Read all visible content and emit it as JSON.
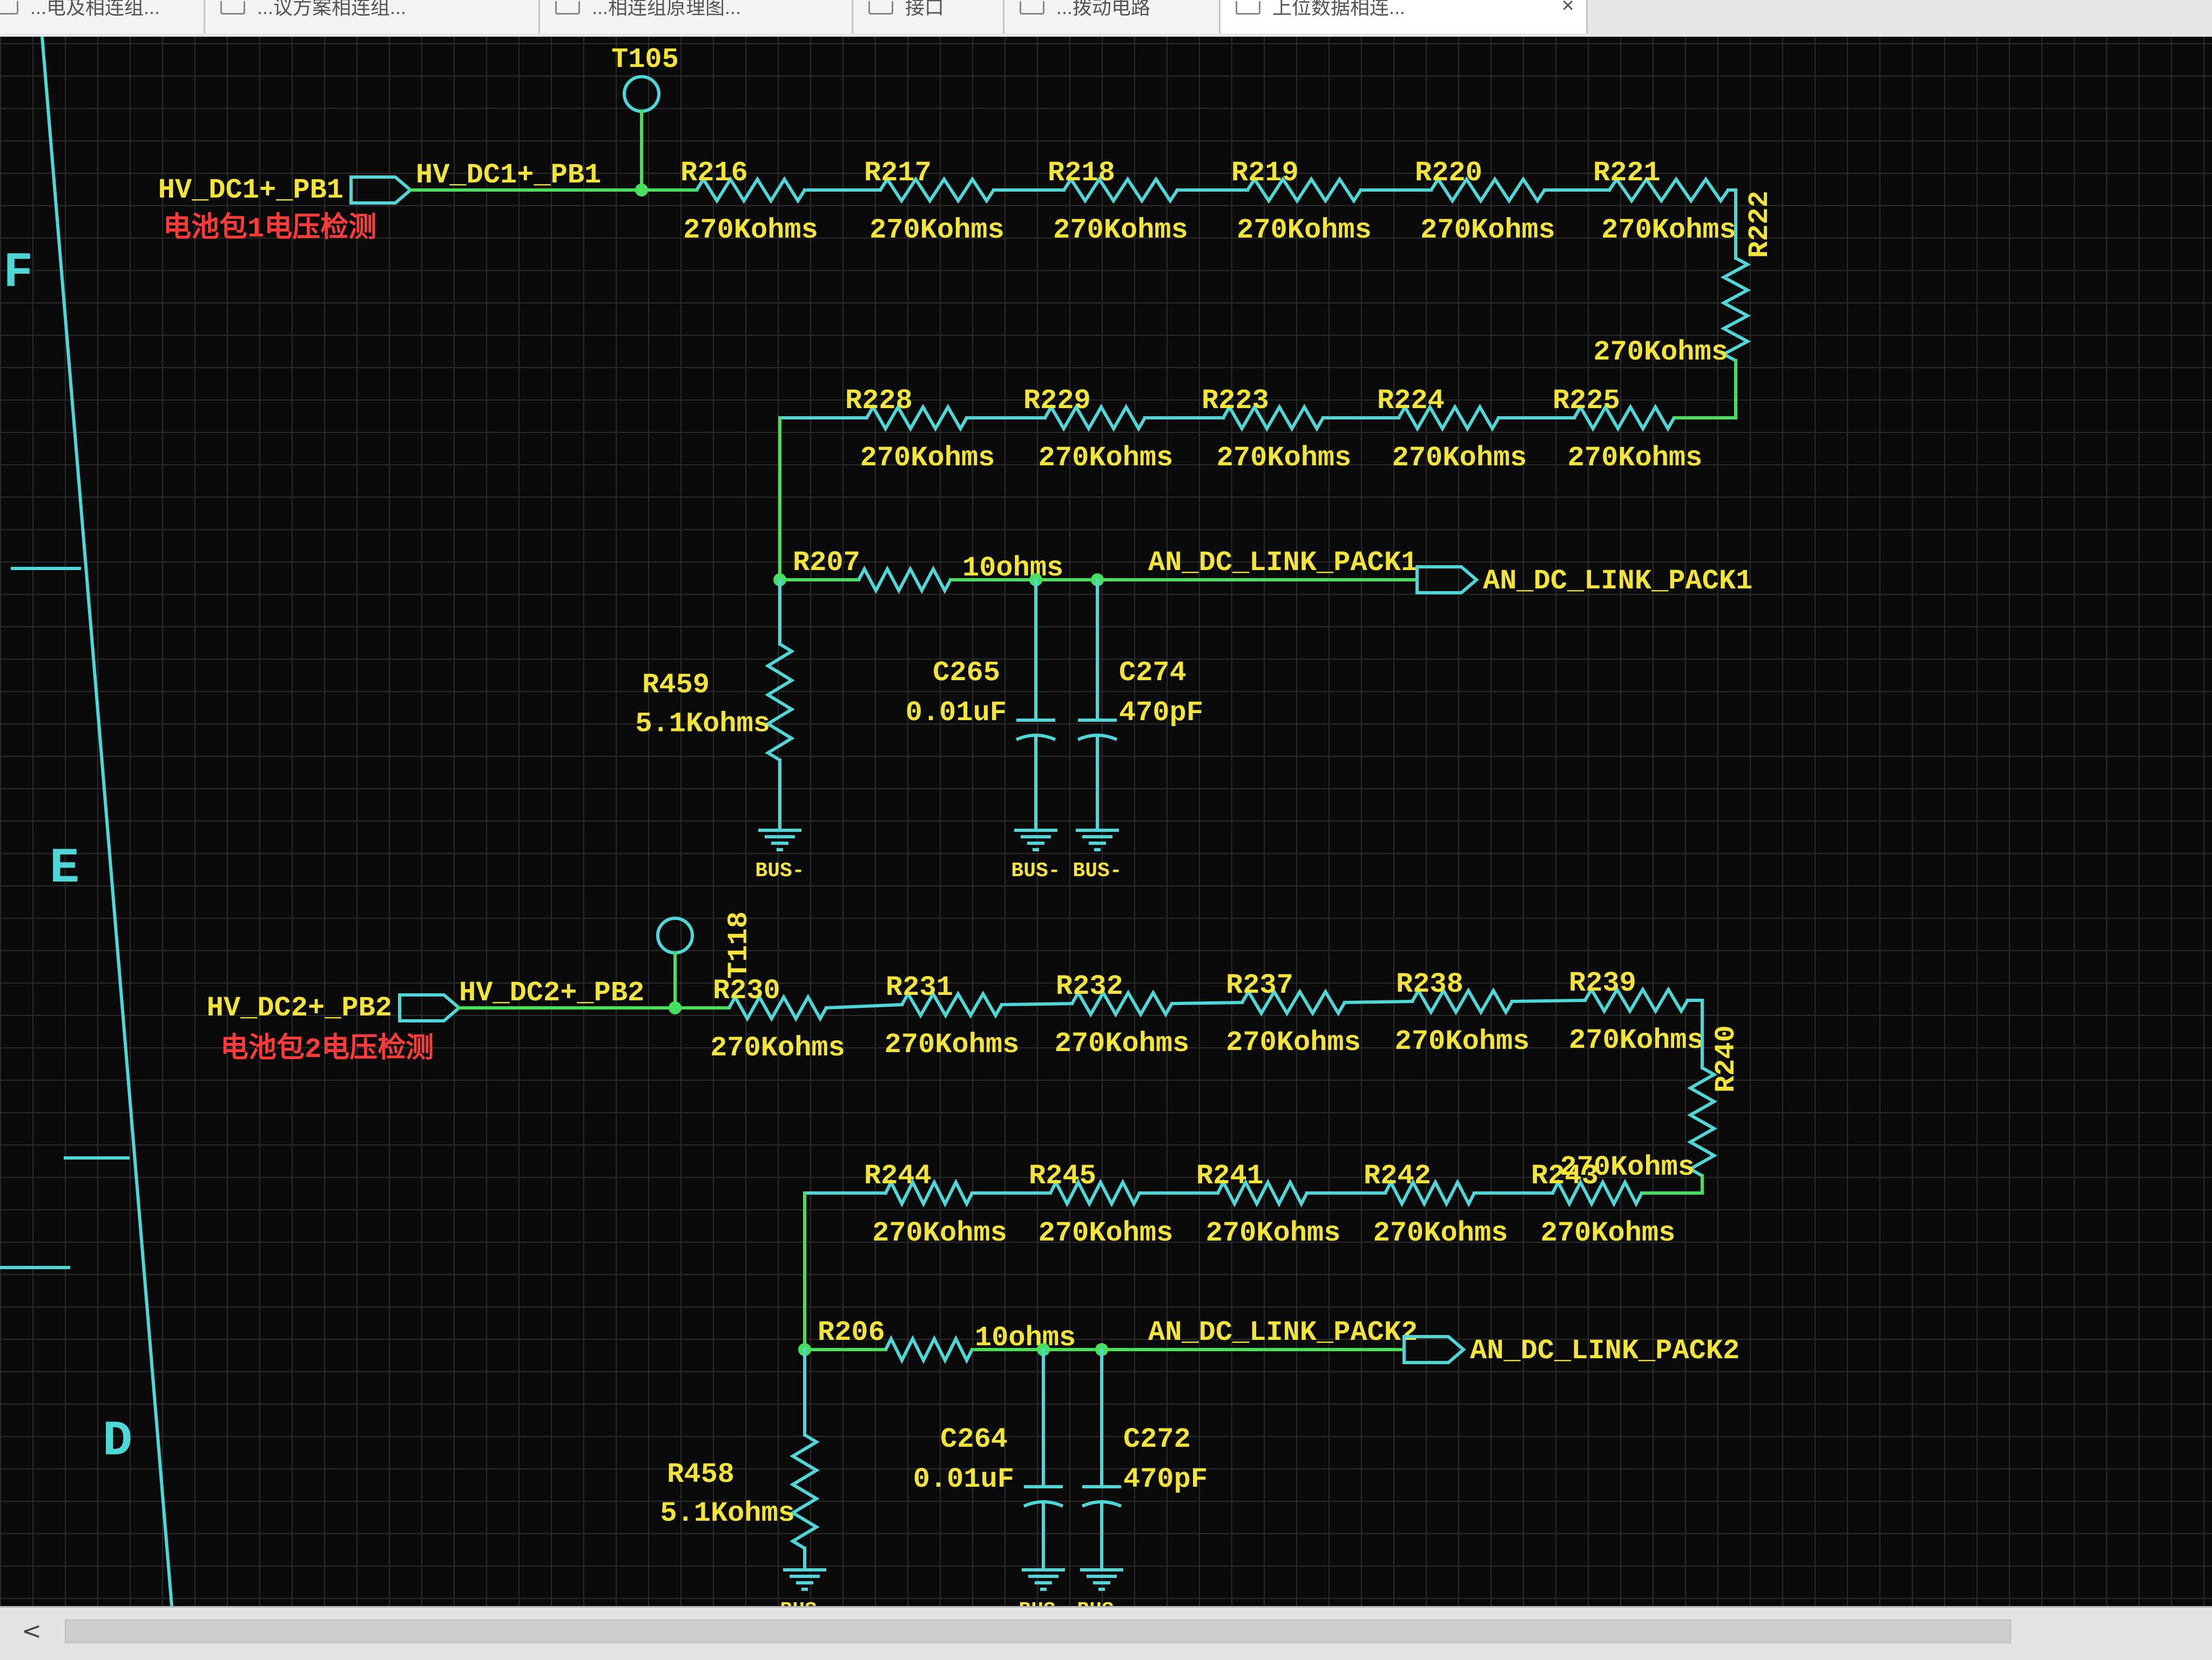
{
  "tabs": [
    {
      "label": "...电及相连组..."
    },
    {
      "label": "...议方案相连组..."
    },
    {
      "label": "...相连组原理图..."
    },
    {
      "label": "接口"
    },
    {
      "label": "...拨动电路"
    },
    {
      "label": "上位数据相连...",
      "active": true
    }
  ],
  "zones": {
    "f": "F",
    "e": "E",
    "d": "D"
  },
  "colors": {
    "wire": "#4fd6d6",
    "net": "#46e05a",
    "label": "#f2e43a",
    "comment": "#ff3b3b",
    "background": "#0a0a0a"
  },
  "circuit1": {
    "testpoint": "T105",
    "port": "HV_DC1+_PB1",
    "comment": "电池包1电压检测",
    "net": "HV_DC1+_PB1",
    "top_row": [
      {
        "ref": "R216",
        "value": "270Kohms"
      },
      {
        "ref": "R217",
        "value": "270Kohms"
      },
      {
        "ref": "R218",
        "value": "270Kohms"
      },
      {
        "ref": "R219",
        "value": "270Kohms"
      },
      {
        "ref": "R220",
        "value": "270Kohms"
      },
      {
        "ref": "R221",
        "value": "270Kohms"
      }
    ],
    "side": {
      "ref": "R222",
      "value": "270Kohms"
    },
    "bottom_row": [
      {
        "ref": "R228",
        "value": "270Kohms"
      },
      {
        "ref": "R229",
        "value": "270Kohms"
      },
      {
        "ref": "R223",
        "value": "270Kohms"
      },
      {
        "ref": "R224",
        "value": "270Kohms"
      },
      {
        "ref": "R225",
        "value": "270Kohms"
      }
    ],
    "series": {
      "ref": "R207",
      "value": "10ohms"
    },
    "pulldown": {
      "ref": "R459",
      "value": "5.1Kohms"
    },
    "cap1": {
      "ref": "C265",
      "value": "0.01uF"
    },
    "cap2": {
      "ref": "C274",
      "value": "470pF"
    },
    "out_net": "AN_DC_LINK_PACK1",
    "out_port": "AN_DC_LINK_PACK1",
    "gnd": [
      "BUS-",
      "BUS-",
      "BUS-"
    ]
  },
  "circuit2": {
    "testpoint": "T118",
    "port": "HV_DC2+_PB2",
    "comment": "电池包2电压检测",
    "net": "HV_DC2+_PB2",
    "top_row": [
      {
        "ref": "R230",
        "value": "270Kohms"
      },
      {
        "ref": "R231",
        "value": "270Kohms"
      },
      {
        "ref": "R232",
        "value": "270Kohms"
      },
      {
        "ref": "R237",
        "value": "270Kohms"
      },
      {
        "ref": "R238",
        "value": "270Kohms"
      },
      {
        "ref": "R239",
        "value": "270Kohms"
      }
    ],
    "side": {
      "ref": "R240",
      "value": "270Kohms"
    },
    "bottom_row": [
      {
        "ref": "R244",
        "value": "270Kohms"
      },
      {
        "ref": "R245",
        "value": "270Kohms"
      },
      {
        "ref": "R241",
        "value": "270Kohms"
      },
      {
        "ref": "R242",
        "value": "270Kohms"
      },
      {
        "ref": "R243",
        "value": "270Kohms"
      }
    ],
    "series": {
      "ref": "R206",
      "value": "10ohms"
    },
    "pulldown": {
      "ref": "R458",
      "value": "5.1Kohms"
    },
    "cap1": {
      "ref": "C264",
      "value": "0.01uF"
    },
    "cap2": {
      "ref": "C272",
      "value": "470pF"
    },
    "out_net": "AN_DC_LINK_PACK2",
    "out_port": "AN_DC_LINK_PACK2",
    "gnd": [
      "BUS-",
      "BUS-",
      "BUS-"
    ]
  },
  "scrollbar": {
    "left_arrow": "<"
  }
}
